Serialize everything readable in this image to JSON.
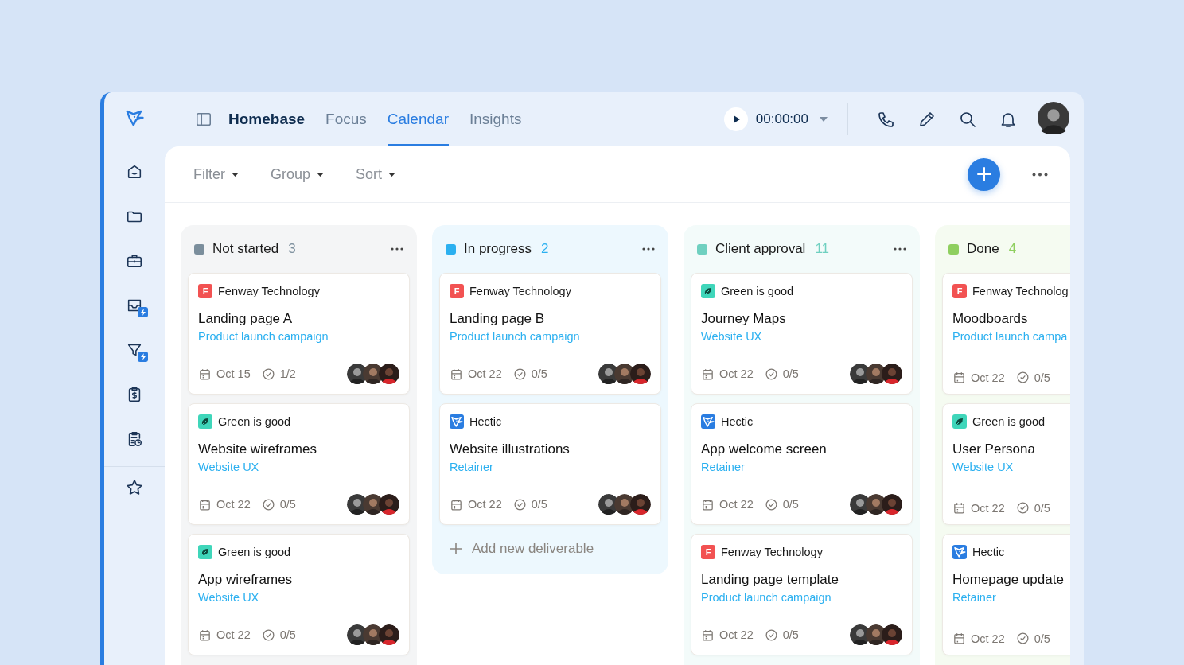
{
  "nav": {
    "title": "Homebase",
    "tabs": [
      {
        "label": "Focus",
        "selected": false
      },
      {
        "label": "Calendar",
        "selected": true
      },
      {
        "label": "Insights",
        "selected": false
      }
    ]
  },
  "timer": {
    "time": "00:00:00"
  },
  "toolbar": {
    "controls": [
      "Filter",
      "Group",
      "Sort"
    ]
  },
  "columns": [
    {
      "name": "Not started",
      "count": "3",
      "color": "#7b8e9c",
      "menu": true,
      "assignees_shown": true,
      "cards": [
        {
          "client": {
            "kind": "letter",
            "letter": "F",
            "name": "Fenway Technology"
          },
          "title": "Landing page A",
          "project": "Product launch campaign",
          "date": "Oct 15",
          "progress": "1/2"
        },
        {
          "client": {
            "kind": "leaf",
            "name": "Green is good"
          },
          "title": "Website wireframes",
          "project": "Website UX",
          "date": "Oct 22",
          "progress": "0/5"
        },
        {
          "client": {
            "kind": "leaf",
            "name": "Green is good"
          },
          "title": "App wireframes",
          "project": "Website UX",
          "date": "Oct 22",
          "progress": "0/5"
        }
      ]
    },
    {
      "name": "In progress",
      "count": "2",
      "color": "#2bb0f0",
      "menu": true,
      "assignees_shown": true,
      "add_label": "Add new deliverable",
      "cards": [
        {
          "client": {
            "kind": "letter",
            "letter": "F",
            "name": "Fenway Technology"
          },
          "title": "Landing page B",
          "project": "Product launch campaign",
          "date": "Oct 22",
          "progress": "0/5"
        },
        {
          "client": {
            "kind": "bird",
            "name": "Hectic"
          },
          "title": "Website illustrations",
          "project": "Retainer",
          "date": "Oct 22",
          "progress": "0/5"
        }
      ]
    },
    {
      "name": "Client approval",
      "count": "11",
      "color": "#6fd0c0",
      "menu": true,
      "assignees_shown": true,
      "cards": [
        {
          "client": {
            "kind": "leaf",
            "name": "Green is good"
          },
          "title": "Journey Maps",
          "project": "Website UX",
          "date": "Oct 22",
          "progress": "0/5"
        },
        {
          "client": {
            "kind": "bird",
            "name": "Hectic"
          },
          "title": "App welcome screen",
          "project": "Retainer",
          "date": "Oct 22",
          "progress": "0/5"
        },
        {
          "client": {
            "kind": "letter",
            "letter": "F",
            "name": "Fenway Technology"
          },
          "title": "Landing page template",
          "project": "Product launch campaign",
          "date": "Oct 22",
          "progress": "0/5"
        }
      ]
    },
    {
      "name": "Done",
      "count": "4",
      "color": "#8fcf5f",
      "menu": false,
      "assignees_shown": false,
      "cards": [
        {
          "client": {
            "kind": "letter",
            "letter": "F",
            "name": "Fenway Technolog"
          },
          "title": "Moodboards",
          "project": "Product launch campa",
          "date": "Oct 22",
          "progress": "0/5"
        },
        {
          "client": {
            "kind": "leaf",
            "name": "Green is good"
          },
          "title": "User Persona",
          "project": "Website UX",
          "date": "Oct 22",
          "progress": "0/5"
        },
        {
          "client": {
            "kind": "bird",
            "name": "Hectic"
          },
          "title": "Homepage update",
          "project": "Retainer",
          "date": "Oct 22",
          "progress": "0/5"
        }
      ]
    }
  ]
}
